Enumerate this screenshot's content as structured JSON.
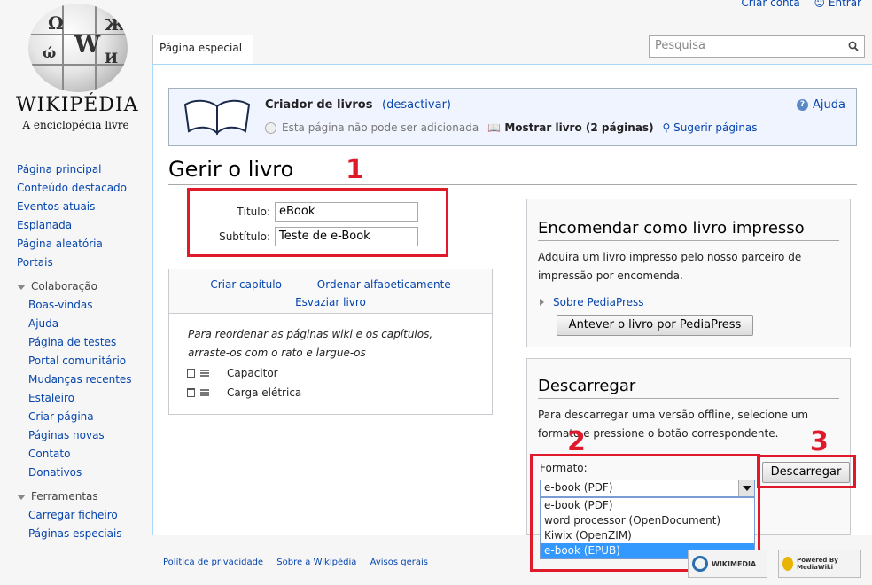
{
  "personal": {
    "create_account": "Criar conta",
    "login": "Entrar"
  },
  "logo": {
    "wordmark": "WIKIPÉDIA",
    "tagline": "A enciclopédia livre"
  },
  "tab": {
    "label": "Página especial"
  },
  "search": {
    "placeholder": "Pesquisa"
  },
  "sidebar": {
    "navigation": [
      "Página principal",
      "Conteúdo destacado",
      "Eventos atuais",
      "Esplanada",
      "Página aleatória",
      "Portais"
    ],
    "collaboration": {
      "heading": "Colaboração",
      "items": [
        "Boas-vindas",
        "Ajuda",
        "Página de testes",
        "Portal comunitário",
        "Mudanças recentes",
        "Estaleiro",
        "Criar página",
        "Páginas novas",
        "Contato",
        "Donativos"
      ]
    },
    "tools": {
      "heading": "Ferramentas",
      "items": [
        "Carregar ficheiro",
        "Páginas especiais"
      ]
    }
  },
  "bookcreator": {
    "title": "Criador de livros",
    "deactivate": "(desactivar)",
    "help": "Ajuda",
    "cannot_add": "Esta página não pode ser adicionada",
    "show_book": "Mostrar livro (2 páginas)",
    "suggest": "Sugerir páginas"
  },
  "page_title": "Gerir o livro",
  "annotations": [
    "1",
    "2",
    "3"
  ],
  "book": {
    "title_label": "Título:",
    "title_value": "eBook",
    "subtitle_label": "Subtítulo:",
    "subtitle_value": "Teste de e-Book"
  },
  "chapters": {
    "create_chapter": "Criar capítulo",
    "sort": "Ordenar alfabeticamente",
    "empty": "Esvaziar livro",
    "hint_line1": "Para reordenar as páginas wiki e os capítulos,",
    "hint_line2": "arraste-os com o rato e largue-os",
    "items": [
      "Capacitor",
      "Carga elétrica"
    ]
  },
  "print": {
    "heading": "Encomendar como livro impresso",
    "text_line1": "Adquira um livro impresso pelo nosso parceiro de",
    "text_line2": "impressão por encomenda.",
    "about": "Sobre PediaPress",
    "preview_button": "Antever o livro por PediaPress"
  },
  "download": {
    "heading": "Descarregar",
    "text_line1": "Para descarregar uma versão offline, selecione um",
    "text_line2": "formato e pressione o botão correspondente.",
    "format_label": "Formato:",
    "selected": "e-book (PDF)",
    "options": [
      "e-book (PDF)",
      "word processor (OpenDocument)",
      "Kiwix (OpenZIM)",
      "e-book (EPUB)"
    ],
    "highlighted_index": 3,
    "button": "Descarregar"
  },
  "footer": {
    "privacy": "Política de privacidade",
    "about": "Sobre a Wikipédia",
    "disclaimers": "Avisos gerais"
  },
  "badges": {
    "wikimedia": "WIKIMEDIA",
    "mediawiki": "Powered By MediaWiki"
  },
  "colors": {
    "link": "#0645ad",
    "annotation": "#e01a2b",
    "highlight": "#3399ff"
  }
}
